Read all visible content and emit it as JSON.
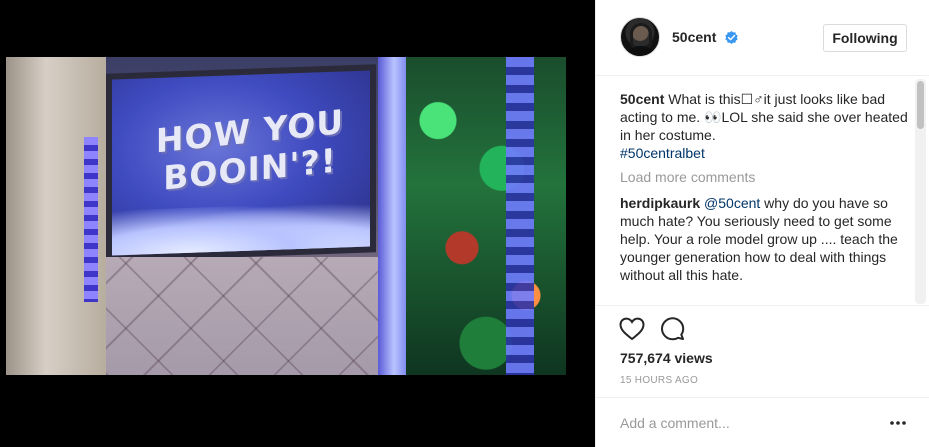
{
  "media": {
    "screen_text": "HOW YOU BOOIN'?!"
  },
  "post": {
    "author": "50cent",
    "verified": true,
    "follow_label": "Following",
    "caption_user": "50cent",
    "caption_text": " What is this☐♂it just looks like bad acting to me. 👀LOL she said she over heated in her costume.",
    "hashtag": "#50centralbet",
    "load_more_label": "Load more comments",
    "comments": [
      {
        "user": "herdipkaurk",
        "mention": "@50cent",
        "text": " why do you have so much hate? You seriously need to get some help. Your a role model grow up .... teach the younger generation how to deal with things without all this hate."
      }
    ],
    "views": "757,674 views",
    "timestamp": "15 HOURS AGO",
    "comment_placeholder": "Add a comment...",
    "accent_color": "#3897f0"
  },
  "icons": {
    "verified": "verified-badge-icon",
    "like": "heart-icon",
    "comment": "comment-icon",
    "more": "more-options-icon"
  }
}
